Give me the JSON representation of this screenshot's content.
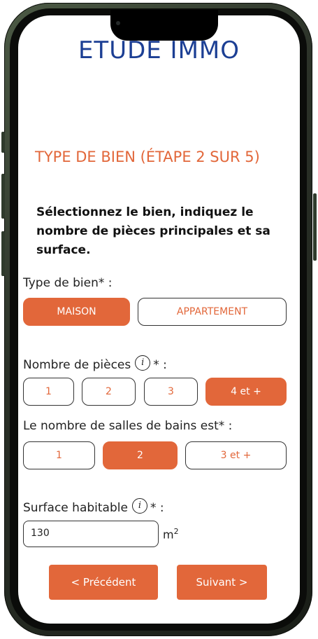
{
  "header": {
    "logo_text": "ETUDE IMMO"
  },
  "step": {
    "title": "TYPE DE BIEN (ÉTAPE 2 SUR 5)",
    "instruction": "Sélectionnez le bien, indiquez le nombre de pièces principales et sa surface."
  },
  "property_type": {
    "label": "Type de bien* :",
    "options": [
      {
        "label": "MAISON",
        "selected": true
      },
      {
        "label": "APPARTEMENT",
        "selected": false
      }
    ]
  },
  "rooms": {
    "label": "Nombre de pièces",
    "suffix": "* :",
    "info_icon": "info-icon",
    "options": [
      {
        "label": "1",
        "selected": false
      },
      {
        "label": "2",
        "selected": false
      },
      {
        "label": "3",
        "selected": false
      },
      {
        "label": "4 et +",
        "selected": true
      }
    ]
  },
  "bathrooms": {
    "label": "Le nombre de salles de bains est* :",
    "options": [
      {
        "label": "1",
        "selected": false
      },
      {
        "label": "2",
        "selected": true
      },
      {
        "label": "3 et +",
        "selected": false
      }
    ]
  },
  "surface": {
    "label": "Surface habitable",
    "suffix": "* :",
    "info_icon": "info-icon",
    "value": "130",
    "unit": "m",
    "unit_exp": "2"
  },
  "navigation": {
    "previous_label": "< Précédent",
    "next_label": "Suivant >"
  },
  "colors": {
    "accent": "#e2673a",
    "brand": "#1c3f94"
  }
}
